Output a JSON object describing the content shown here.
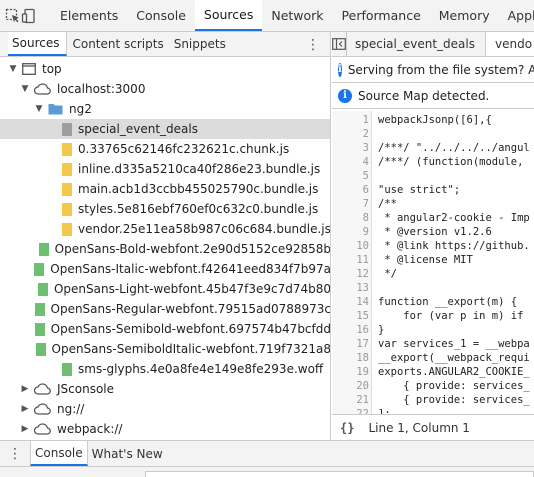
{
  "toolbar": {
    "inspect_icon": "cursor-select-icon",
    "device_icon": "device-toggle-icon",
    "tabs": [
      "Elements",
      "Console",
      "Sources",
      "Network",
      "Performance",
      "Memory",
      "Applic"
    ],
    "active_tab": "Sources",
    "accent": "#1a73e8"
  },
  "navigator": {
    "tabs": [
      "Sources",
      "Content scripts",
      "Snippets"
    ],
    "active_tab": "Sources",
    "more_icon": "⋮",
    "tree": [
      {
        "label": "top",
        "icon": "frame-icon",
        "expanded": true,
        "depth": 0
      },
      {
        "label": "localhost:3000",
        "icon": "cloud-icon",
        "expanded": true,
        "depth": 1
      },
      {
        "label": "ng2",
        "icon": "folder-icon",
        "expanded": true,
        "depth": 2
      },
      {
        "label": "special_event_deals",
        "icon": "file-grey-icon",
        "depth": 3,
        "selected": true
      },
      {
        "label": "0.33765c62146fc232621c.chunk.js",
        "icon": "file-yellow-icon",
        "depth": 3
      },
      {
        "label": "inline.d335a5210ca40f286e23.bundle.js",
        "icon": "file-yellow-icon",
        "depth": 3
      },
      {
        "label": "main.acb1d3ccbb455025790c.bundle.js",
        "icon": "file-yellow-icon",
        "depth": 3
      },
      {
        "label": "styles.5e816ebf760ef0c632c0.bundle.js",
        "icon": "file-yellow-icon",
        "depth": 3
      },
      {
        "label": "vendor.25e11ea58b987c06c684.bundle.js",
        "icon": "file-yellow-icon",
        "depth": 3
      },
      {
        "label": "OpenSans-Bold-webfont.2e90d5152ce92858b",
        "icon": "file-green-icon",
        "depth": 3
      },
      {
        "label": "OpenSans-Italic-webfont.f42641eed834f7b97a",
        "icon": "file-green-icon",
        "depth": 3
      },
      {
        "label": "OpenSans-Light-webfont.45b47f3e9c7d74b80",
        "icon": "file-green-icon",
        "depth": 3
      },
      {
        "label": "OpenSans-Regular-webfont.79515ad0788973c",
        "icon": "file-green-icon",
        "depth": 3
      },
      {
        "label": "OpenSans-Semibold-webfont.697574b47bcfdd",
        "icon": "file-green-icon",
        "depth": 3
      },
      {
        "label": "OpenSans-SemiboldItalic-webfont.719f7321a8",
        "icon": "file-green-icon",
        "depth": 3
      },
      {
        "label": "sms-glyphs.4e0a8fe4e149e8fe293e.woff",
        "icon": "file-green-icon",
        "depth": 3
      },
      {
        "label": "JSconsole",
        "icon": "cloud-icon",
        "expanded": false,
        "depth": 1
      },
      {
        "label": "ng://",
        "icon": "cloud-icon",
        "expanded": false,
        "depth": 1
      },
      {
        "label": "webpack://",
        "icon": "cloud-icon",
        "expanded": false,
        "depth": 1
      }
    ]
  },
  "editor": {
    "toggle_icon": "toggle-navigator-icon",
    "tabs": [
      "special_event_deals",
      "vendo"
    ],
    "active_tab": "vendo",
    "infobars": [
      "Serving from the file system? Add",
      "Source Map detected."
    ],
    "lines": [
      {
        "n": "1",
        "text": "webpackJsonp([6],{",
        "kind": "plain"
      },
      {
        "n": "2",
        "text": "",
        "kind": "plain"
      },
      {
        "n": "3",
        "text": "/***/ \"../../../../angul",
        "kind": "comment"
      },
      {
        "n": "4",
        "text": "/***/ (function(module,",
        "kind": "comment-mixed"
      },
      {
        "n": "5",
        "text": "",
        "kind": "plain"
      },
      {
        "n": "6",
        "text": "\"use strict\";",
        "kind": "string"
      },
      {
        "n": "7",
        "text": "/**",
        "kind": "doc"
      },
      {
        "n": "8",
        "text": " * angular2-cookie - Imp",
        "kind": "doc"
      },
      {
        "n": "9",
        "text": " * @version v1.2.6",
        "kind": "doc"
      },
      {
        "n": "10",
        "text": " * @link https://github.",
        "kind": "doc"
      },
      {
        "n": "11",
        "text": " * @license MIT",
        "kind": "doc"
      },
      {
        "n": "12",
        "text": " */",
        "kind": "doc"
      },
      {
        "n": "13",
        "text": "",
        "kind": "plain"
      },
      {
        "n": "14",
        "text": "function __export(m) {",
        "kind": "keyword"
      },
      {
        "n": "15",
        "text": "    for (var p in m) if",
        "kind": "keyword2"
      },
      {
        "n": "16",
        "text": "}",
        "kind": "plain"
      },
      {
        "n": "17",
        "text": "var services_1 = __webpa",
        "kind": "keyword"
      },
      {
        "n": "18",
        "text": "__export(__webpack_requi",
        "kind": "plain"
      },
      {
        "n": "19",
        "text": "exports.ANGULAR2_COOKIE_",
        "kind": "plain"
      },
      {
        "n": "20",
        "text": "    { provide: services_",
        "kind": "plain"
      },
      {
        "n": "21",
        "text": "    { provide: services_",
        "kind": "plain"
      },
      {
        "n": "22",
        "text": "];",
        "kind": "plain"
      },
      {
        "n": "23",
        "text": "function cookieServiceFa",
        "kind": "keyword"
      }
    ],
    "status": {
      "braces": "{}",
      "position": "Line 1, Column 1"
    }
  },
  "drawer": {
    "more_icon": "⋮",
    "tabs": [
      "Console",
      "What's New"
    ],
    "active_tab": "Console"
  }
}
